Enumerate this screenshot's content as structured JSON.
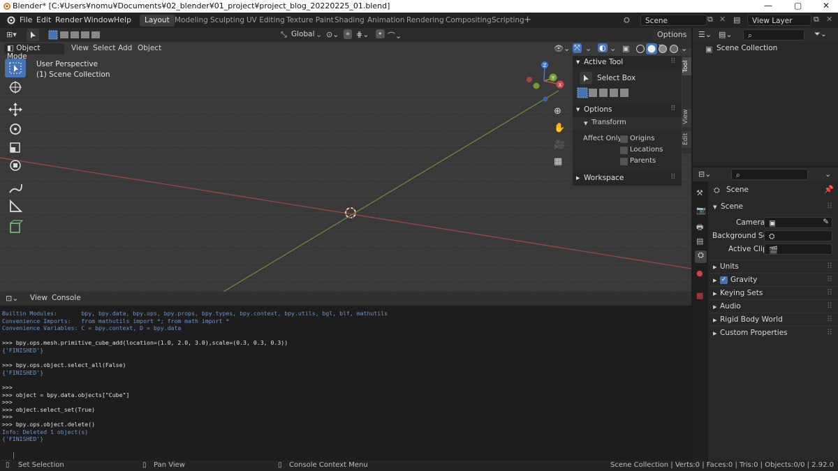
{
  "titlebar": {
    "title": "Blender* [C:¥Users¥nomu¥Documents¥02_blender¥01_project¥project_blog_20220225_01.blend]",
    "min": "—",
    "max": "▢",
    "close": "✕"
  },
  "menus": [
    "File",
    "Edit",
    "Render",
    "Window",
    "Help"
  ],
  "workspaces": [
    "Layout",
    "Modeling",
    "Sculpting",
    "UV Editing",
    "Texture Paint",
    "Shading",
    "Animation",
    "Rendering",
    "Compositing",
    "Scripting"
  ],
  "scene": {
    "name": "Scene",
    "view_layer": "View Layer"
  },
  "viewport": {
    "transform": "Global",
    "options": "Options",
    "mode": "Object Mode",
    "menus": [
      "View",
      "Select",
      "Add",
      "Object"
    ],
    "perspective": "User Perspective",
    "collection": "(1) Scene Collection",
    "gizmo": {
      "z": "Z",
      "y": "Y",
      "x": "X"
    },
    "vtabs": [
      "Tool",
      "View",
      "Edit"
    ]
  },
  "npanel": {
    "active_tool": "Active Tool",
    "tool_name": "Select Box",
    "options": "Options",
    "transform": "Transform",
    "affect_only": "Affect Only",
    "affect_items": [
      "Origins",
      "Locations",
      "Parents"
    ],
    "workspace": "Workspace"
  },
  "console": {
    "menus": [
      "View",
      "Console"
    ],
    "lines": [
      {
        "t": "Builtin Modules:       bpy, bpy.data, bpy.ops, bpy.props, bpy.types, bpy.context, bpy.utils, bgl, blf, mathutils",
        "c": "blue"
      },
      {
        "t": "Convenience Imports:   from mathutils import *; from math import *",
        "c": "blue"
      },
      {
        "t": "Convenience Variables: C = bpy.context, D = bpy.data",
        "c": "blue"
      },
      {
        "t": "",
        "c": "white"
      },
      {
        "t": ">>> bpy.ops.mesh.primitive_cube_add(location=(1.0, 2.0, 3.0),scale=(0.3, 0.3, 0.3))",
        "c": "white"
      },
      {
        "t": "{'FINISHED'}",
        "c": "blue"
      },
      {
        "t": "",
        "c": "white"
      },
      {
        "t": ">>> bpy.ops.object.select_all(False)",
        "c": "white"
      },
      {
        "t": "{'FINISHED'}",
        "c": "blue"
      },
      {
        "t": "",
        "c": "white"
      },
      {
        "t": ">>>",
        "c": "white"
      },
      {
        "t": ">>> object = bpy.data.objects[\"Cube\"]",
        "c": "white"
      },
      {
        "t": ">>>",
        "c": "white"
      },
      {
        "t": ">>> object.select_set(True)",
        "c": "white"
      },
      {
        "t": ">>>",
        "c": "white"
      },
      {
        "t": ">>> bpy.ops.object.delete()",
        "c": "white"
      },
      {
        "t": "Info: Deleted 1 object(s)",
        "c": "blue"
      },
      {
        "t": "{'FINISHED'}",
        "c": "blue"
      },
      {
        "t": "",
        "c": "white"
      },
      {
        "t": "",
        "c": "white"
      },
      {
        "t": ">>>",
        "c": "white"
      }
    ]
  },
  "outliner": {
    "root": "Scene Collection"
  },
  "properties": {
    "scene_name": "Scene",
    "section": "Scene",
    "camera_label": "Camera",
    "bg_label": "Background Sc...",
    "clip_label": "Active Clip",
    "panels": [
      "Units",
      "Gravity",
      "Keying Sets",
      "Audio",
      "Rigid Body World",
      "Custom Properties"
    ]
  },
  "status": {
    "left": "Set Selection",
    "mid": "Pan View",
    "right": "Console Context Menu",
    "stats": "Scene Collection | Verts:0 | Faces:0 | Tris:0 | Objects:0/0 | 2.92.0"
  },
  "colors": {
    "accent": "#4772b3",
    "x_axis": "#c94a4a",
    "y_axis": "#7ba03b",
    "z_axis": "#3f7cd8"
  }
}
